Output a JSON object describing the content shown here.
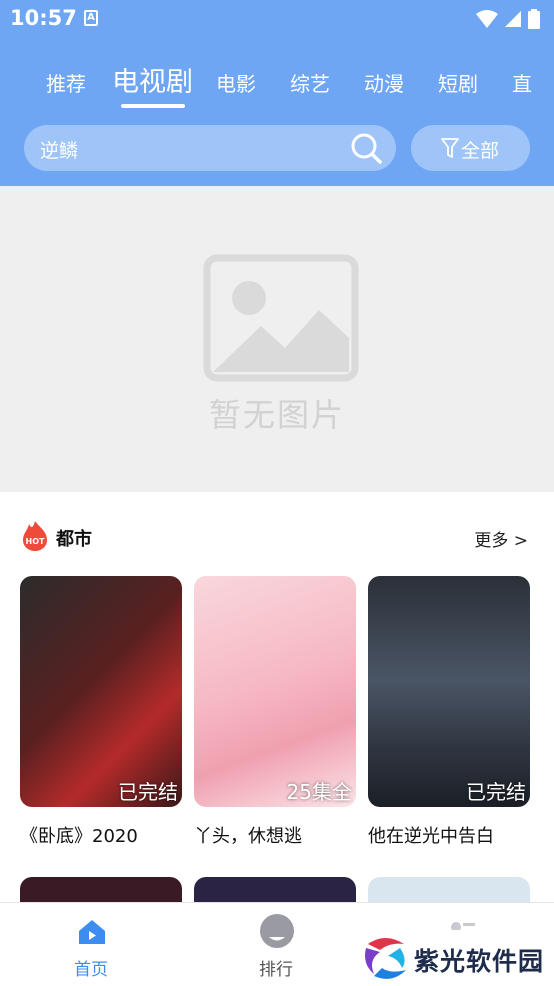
{
  "status_bar": {
    "time": "10:57",
    "notification_letter": "A"
  },
  "tabs": [
    {
      "label": "推荐",
      "active": false
    },
    {
      "label": "电视剧",
      "active": true
    },
    {
      "label": "电影",
      "active": false
    },
    {
      "label": "综艺",
      "active": false
    },
    {
      "label": "动漫",
      "active": false
    },
    {
      "label": "短剧",
      "active": false
    },
    {
      "label": "直",
      "active": false
    }
  ],
  "search": {
    "query": "逆鳞",
    "icon": "search-icon"
  },
  "filter": {
    "label": "全部",
    "icon": "filter-icon"
  },
  "banner": {
    "placeholder_text": "暂无图片"
  },
  "section": {
    "badge_text": "HOT",
    "title": "都市",
    "more_label": "更多 >",
    "items": [
      {
        "title": "《卧底》2020",
        "status": "已完结"
      },
      {
        "title": "丫头，休想逃",
        "status": "25集全"
      },
      {
        "title": "他在逆光中告白",
        "status": "已完结"
      }
    ]
  },
  "bottom_nav": [
    {
      "label": "首页",
      "active": true,
      "icon": "home-icon"
    },
    {
      "label": "排行",
      "active": false,
      "icon": "ranking-icon"
    },
    {
      "label": "",
      "active": false,
      "icon": "profile-icon"
    }
  ],
  "watermark": {
    "text": "紫光软件园"
  },
  "colors": {
    "header": "#6ea6f4",
    "accent": "#3d8cf0",
    "badge": "#f04a3a"
  }
}
